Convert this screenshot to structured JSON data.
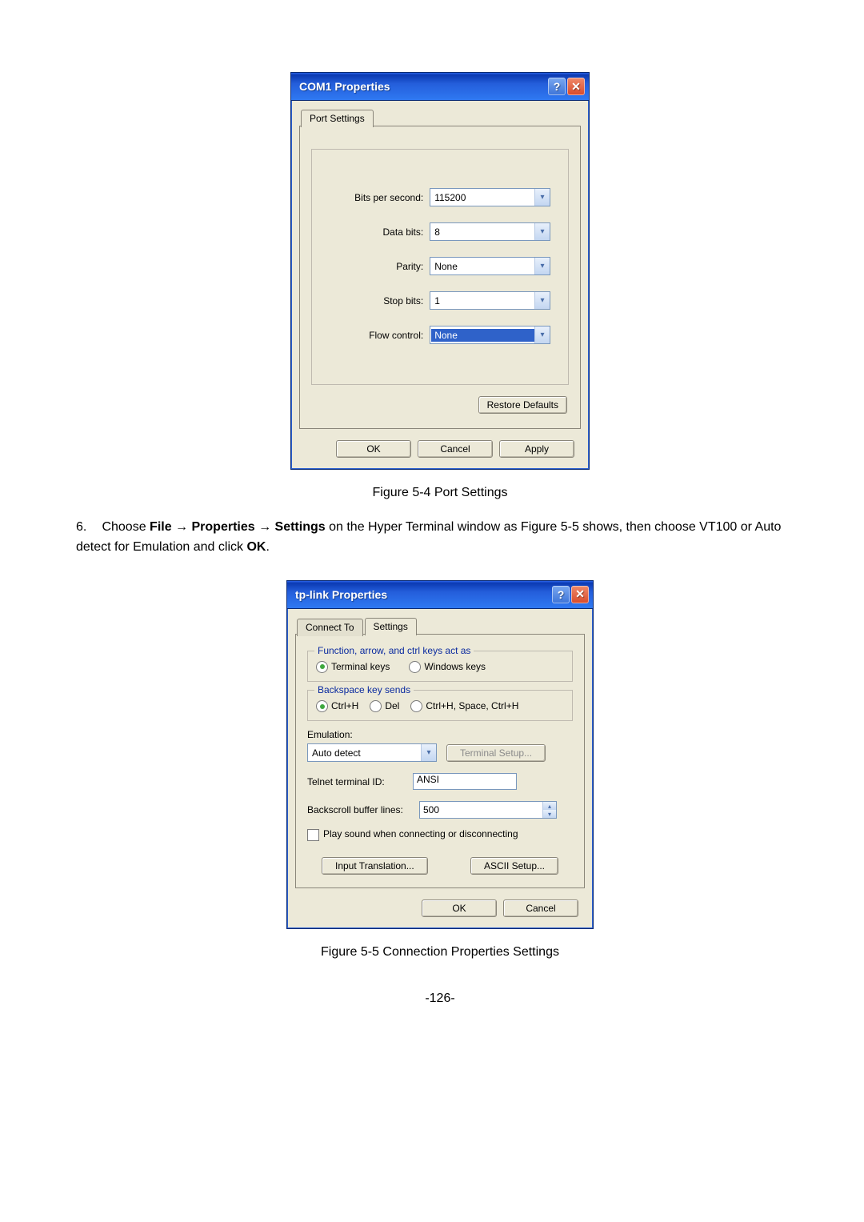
{
  "dialog1": {
    "title": "COM1 Properties",
    "tab": "Port Settings",
    "labels": {
      "bps": "Bits per second:",
      "databits": "Data bits:",
      "parity": "Parity:",
      "stopbits": "Stop bits:",
      "flow": "Flow control:"
    },
    "values": {
      "bps": "115200",
      "databits": "8",
      "parity": "None",
      "stopbits": "1",
      "flow": "None"
    },
    "buttons": {
      "restore": "Restore Defaults",
      "ok": "OK",
      "cancel": "Cancel",
      "apply": "Apply"
    }
  },
  "caption1": "Figure 5-4 Port Settings",
  "step": {
    "num": "6.",
    "prefix": "Choose ",
    "bold1": "File → Properties → Settings",
    "mid": " on the Hyper Terminal window as Figure 5-5 shows, then choose VT100 or Auto detect for Emulation and click ",
    "bold2": "OK",
    "suffix": "."
  },
  "dialog2": {
    "title": "tp-link Properties",
    "tabs": {
      "connect": "Connect To",
      "settings": "Settings"
    },
    "group1": {
      "legend": "Function, arrow, and ctrl keys act as",
      "r1": "Terminal keys",
      "r2": "Windows keys"
    },
    "group2": {
      "legend": "Backspace key sends",
      "r1": "Ctrl+H",
      "r2": "Del",
      "r3": "Ctrl+H, Space, Ctrl+H"
    },
    "emulation_label": "Emulation:",
    "emulation_value": "Auto detect",
    "terminal_setup": "Terminal Setup...",
    "telnet_label": "Telnet terminal ID:",
    "telnet_value": "ANSI",
    "backscroll_label": "Backscroll buffer lines:",
    "backscroll_value": "500",
    "play_sound": "Play sound when connecting or disconnecting",
    "input_translation": "Input Translation...",
    "ascii_setup": "ASCII Setup...",
    "ok": "OK",
    "cancel": "Cancel"
  },
  "caption2": "Figure 5-5 Connection Properties Settings",
  "page_number": "-126-",
  "icons": {
    "help": "?",
    "close": "✕",
    "chevron": "▾",
    "up": "▴",
    "down": "▾"
  }
}
